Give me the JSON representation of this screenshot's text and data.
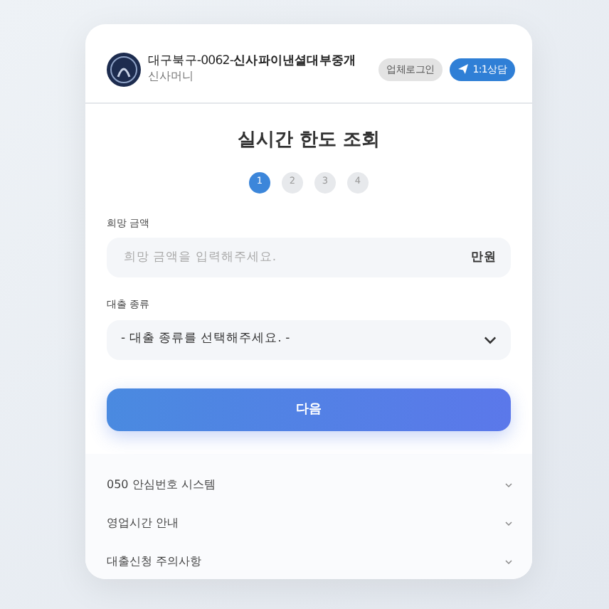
{
  "header": {
    "title_prefix": "대구북구-0062-",
    "title_bold": "신사파이낸셜대부중개",
    "subtitle": "신사머니",
    "buttons": [
      {
        "label": "업체로그인",
        "kind": "secondary"
      },
      {
        "label": "1:1상담",
        "kind": "primary"
      }
    ]
  },
  "title": "실시간 한도 조회",
  "steps": [
    {
      "label": "1",
      "selected": true
    },
    {
      "label": "2",
      "selected": false
    },
    {
      "label": "3",
      "selected": false
    },
    {
      "label": "4",
      "selected": false
    }
  ],
  "fields": [
    {
      "kind": "input",
      "label": "희망 금액",
      "placeholder": "희망 금액을 입력해주세요.",
      "unit": "만원"
    },
    {
      "kind": "select",
      "label": "대출 종류",
      "value": "- 대출 종류를 선택해주세요. -"
    }
  ],
  "next_button": "다음",
  "accordion": [
    {
      "label": "050 안심번호 시스템",
      "expanded": false
    },
    {
      "label": "영업시간 안내",
      "expanded": false
    },
    {
      "label": "대출신청 주의사항",
      "expanded": false
    }
  ]
}
